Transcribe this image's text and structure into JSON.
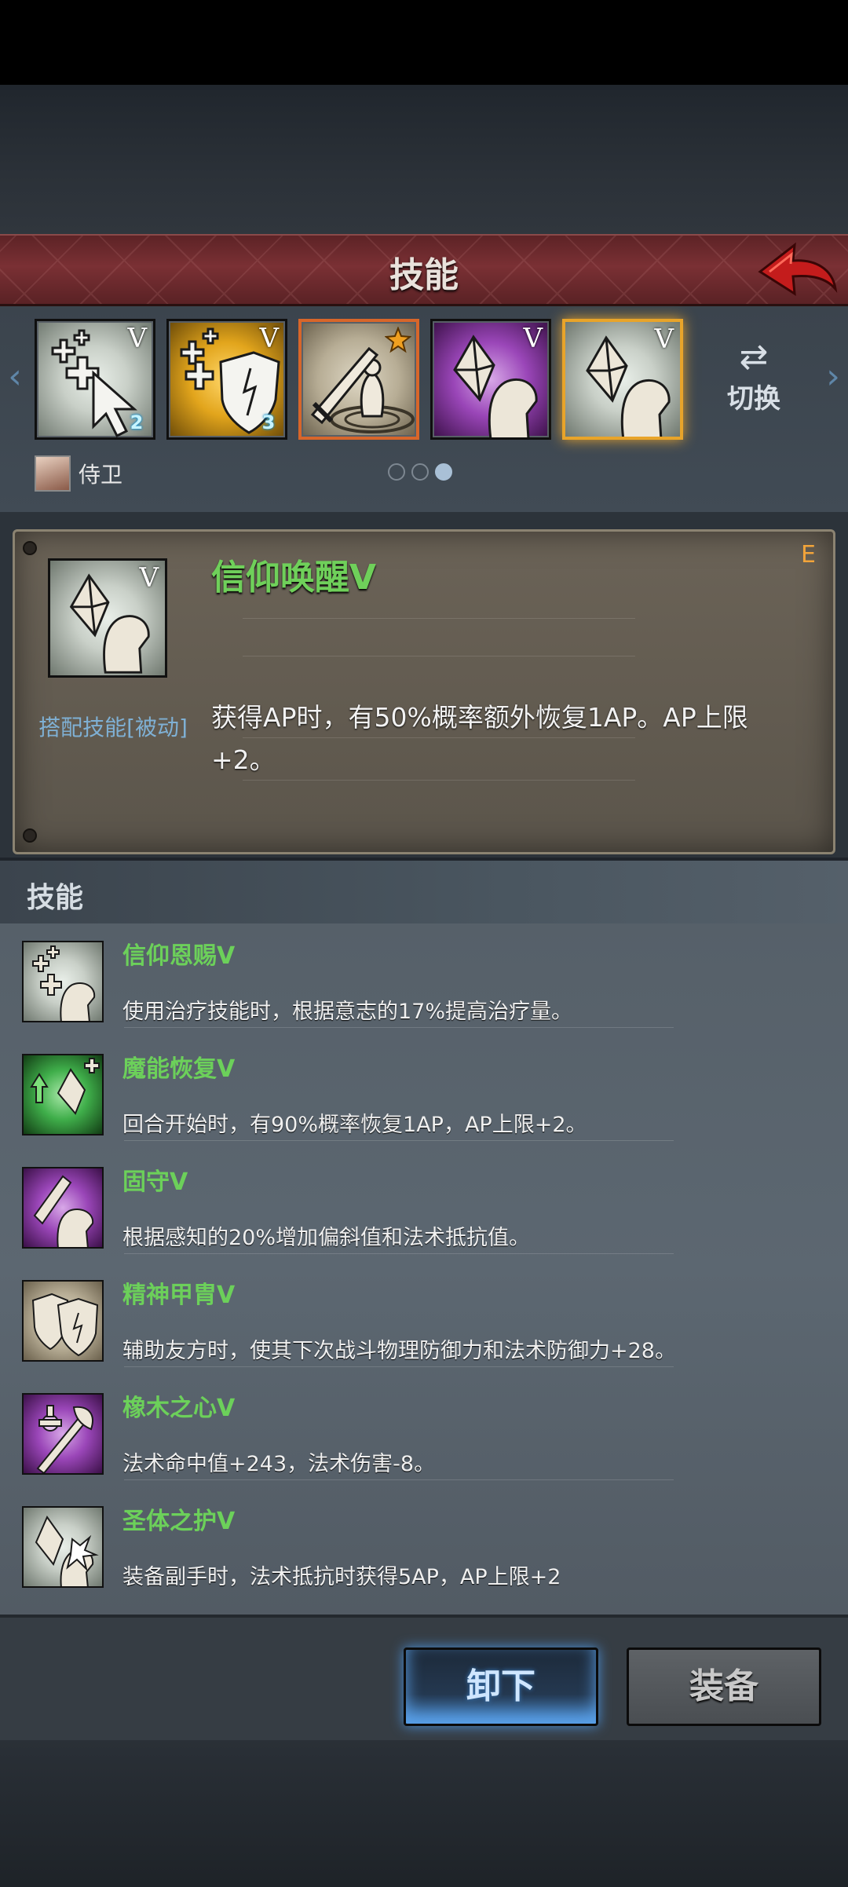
{
  "header": {
    "title": "技能"
  },
  "tabs": {
    "slots": [
      {
        "name": "heal-cursor",
        "v": "V",
        "badge": "2"
      },
      {
        "name": "heal-shield",
        "v": "V",
        "badge": "3"
      },
      {
        "name": "sword-ward",
        "v": "",
        "badge": ""
      },
      {
        "name": "crystal-purple",
        "v": "V",
        "badge": ""
      },
      {
        "name": "crystal-selected",
        "v": "V",
        "badge": ""
      }
    ],
    "switch_label": "切换",
    "owner_name": "侍卫",
    "page_count": 3,
    "active_page": 3
  },
  "detail": {
    "name": "信仰唤醒V",
    "rank": "E",
    "v": "V",
    "tag": "搭配技能[被动]",
    "description": "获得AP时，有50%概率额外恢复1AP。AP上限+2。"
  },
  "skills_section": {
    "title": "技能"
  },
  "skills": [
    {
      "name": "信仰恩赐V",
      "desc": "使用治疗技能时，根据意志的17%提高治疗量。",
      "icon": "faith-blessing-icon"
    },
    {
      "name": "魔能恢复V",
      "desc": "回合开始时，有90%概率恢复1AP，AP上限+2。",
      "icon": "mana-recovery-icon"
    },
    {
      "name": "固守V",
      "desc": "根据感知的20%增加偏斜值和法术抵抗值。",
      "icon": "steadfast-icon"
    },
    {
      "name": "精神甲胄V",
      "desc": "辅助友方时，使其下次战斗物理防御力和法术防御力+28。",
      "icon": "spirit-armor-icon"
    },
    {
      "name": "橡木之心V",
      "desc": "法术命中值+243，法术伤害-8。",
      "icon": "oak-heart-icon"
    },
    {
      "name": "圣体之护V",
      "desc": "装备副手时，法术抵抗时获得5AP，AP上限+2",
      "icon": "holy-body-icon"
    }
  ],
  "buttons": {
    "unequip": "卸下",
    "equip": "装备"
  },
  "colors": {
    "accent_green": "#6cd05a",
    "header_red": "#7a3034",
    "rank_orange": "#f2a43a",
    "unequip_blue": "#4a8ccf"
  }
}
